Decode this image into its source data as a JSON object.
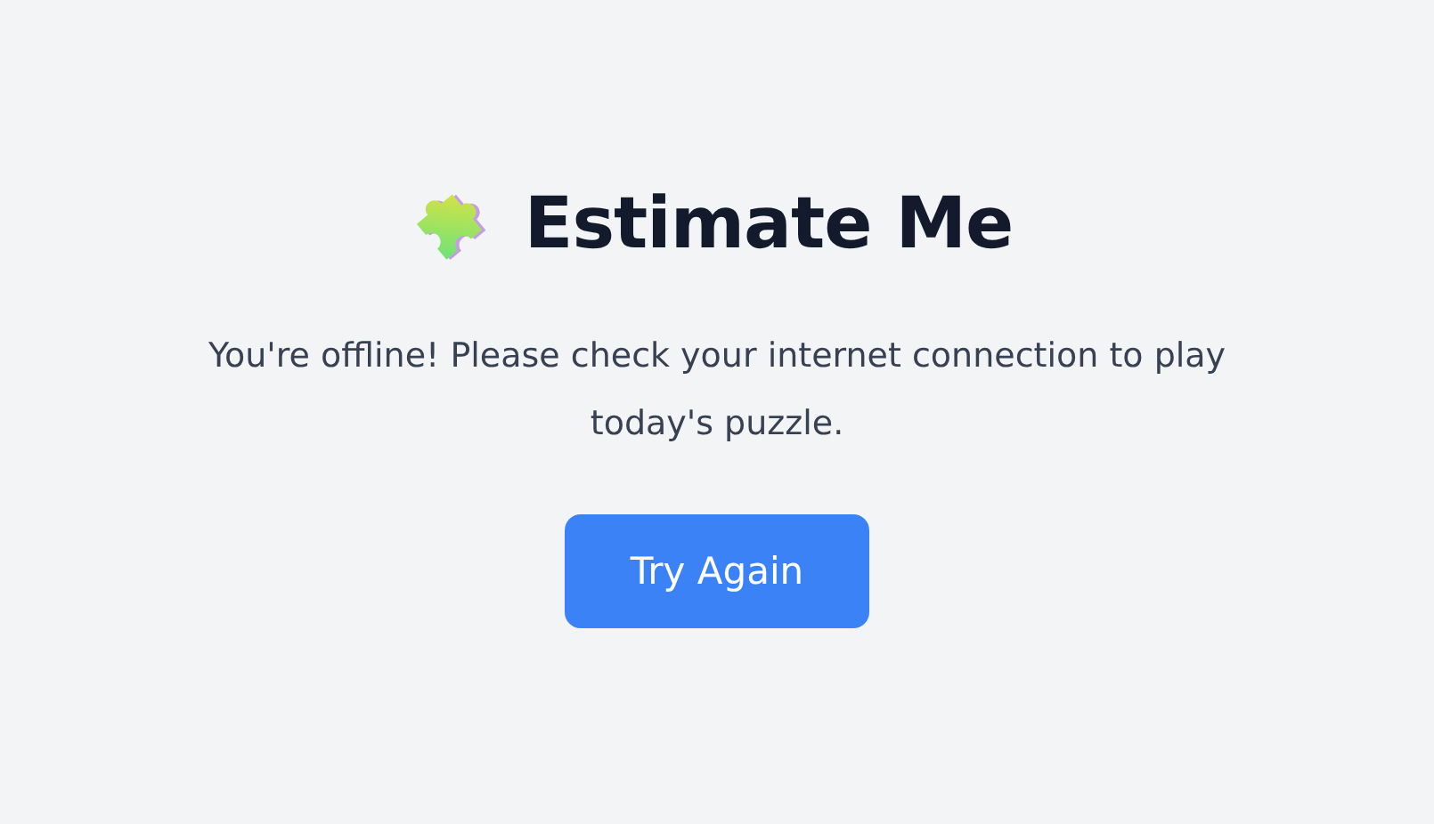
{
  "title": "Estimate Me",
  "message": "You're offline! Please check your internet connection to play today's puzzle.",
  "button": "Try Again"
}
